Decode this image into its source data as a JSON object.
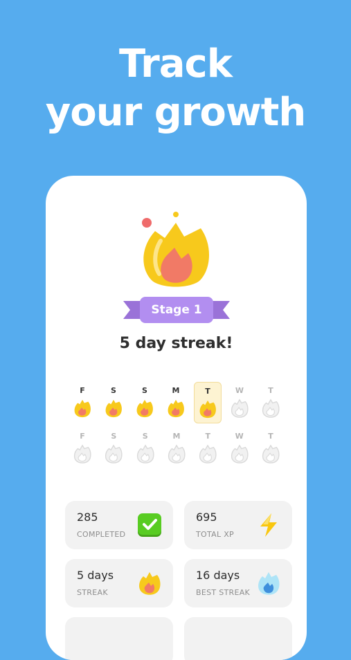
{
  "headline": {
    "line1": "Track",
    "line2": "your growth"
  },
  "stage": {
    "label": "Stage 1"
  },
  "streak": {
    "title": "5 day streak!"
  },
  "week1": [
    {
      "day": "F",
      "state": "done"
    },
    {
      "day": "S",
      "state": "done"
    },
    {
      "day": "S",
      "state": "done"
    },
    {
      "day": "M",
      "state": "done"
    },
    {
      "day": "T",
      "state": "today"
    },
    {
      "day": "W",
      "state": "empty"
    },
    {
      "day": "T",
      "state": "empty"
    }
  ],
  "week2": [
    {
      "day": "F",
      "state": "empty"
    },
    {
      "day": "S",
      "state": "empty"
    },
    {
      "day": "S",
      "state": "empty"
    },
    {
      "day": "M",
      "state": "empty"
    },
    {
      "day": "T",
      "state": "empty"
    },
    {
      "day": "W",
      "state": "empty"
    },
    {
      "day": "T",
      "state": "empty"
    }
  ],
  "stats": {
    "completed": {
      "value": "285",
      "caption": "COMPLETED",
      "icon": "checkmark-icon"
    },
    "total_xp": {
      "value": "695",
      "caption": "TOTAL XP",
      "icon": "lightning-icon"
    },
    "streak": {
      "value": "5 days",
      "caption": "STREAK",
      "icon": "flame-icon"
    },
    "best_streak": {
      "value": "16 days",
      "caption": "BEST STREAK",
      "icon": "blue-flame-icon"
    }
  },
  "colors": {
    "background": "#56acee",
    "ribbon": "#b28ef0",
    "flame_outer": "#f7c91c",
    "flame_inner": "#f17a66",
    "check_green": "#58cc22",
    "xp_yellow": "#f9c70f"
  }
}
